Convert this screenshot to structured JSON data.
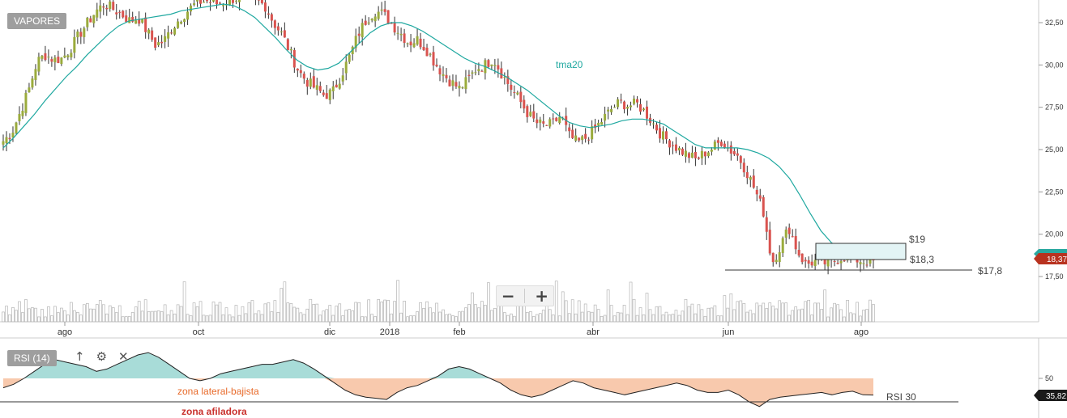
{
  "title": "VAPORES",
  "rsi_title": "RSI (14)",
  "icons": {
    "move_up": "arrow-up-icon",
    "settings": "gear-icon",
    "close": "close-icon"
  },
  "zoom": {
    "minus": "−",
    "plus": "+"
  },
  "colors": {
    "up_candle": "#9aab3c",
    "down_candle": "#d9534f",
    "sma_line": "#1fa8a0",
    "volume_bar": "#b5b5b5",
    "rsi_overbought_fill": "#a8dcd8",
    "rsi_oversold_fill": "#f8c9ad",
    "price_tag_teal": "#2aa8a0",
    "price_tag_red": "#b8321f"
  },
  "chart_data": [
    {
      "type": "candlestick",
      "ylim": [
        15.0,
        33.5
      ],
      "y_ticks": [
        "32,50",
        "30,00",
        "27,50",
        "25,00",
        "22,50",
        "20,00",
        "17,50"
      ],
      "y_tick_values": [
        32.5,
        30.0,
        27.5,
        25.0,
        22.5,
        20.0,
        17.5
      ],
      "x_ticks": [
        "ago",
        "oct",
        "dic",
        "2018",
        "feb",
        "abr",
        "jun",
        "ago"
      ],
      "overlay_label": "tma20",
      "annotations": {
        "box_high": "$19",
        "box_low": "$18,3",
        "support": "$17,8",
        "box_high_value": 19.0,
        "box_low_value": 18.3,
        "support_value": 17.8
      },
      "last_price_tags": [
        "18,37"
      ],
      "close_series": [
        25.5,
        26.0,
        27.2,
        28.5,
        30.2,
        30.6,
        30.3,
        30.4,
        31.0,
        31.8,
        32.5,
        33.2,
        33.6,
        33.3,
        33.0,
        32.6,
        32.8,
        32.0,
        31.2,
        31.4,
        32.2,
        32.8,
        33.3,
        33.7,
        33.8,
        33.6,
        33.7,
        33.9,
        34.0,
        34.0,
        33.8,
        33.5,
        32.5,
        31.8,
        30.7,
        29.6,
        29.0,
        28.6,
        28.2,
        28.4,
        29.4,
        30.5,
        31.8,
        32.7,
        33.2,
        33.0,
        32.4,
        31.9,
        31.3,
        31.5,
        31.0,
        30.2,
        29.5,
        29.0,
        28.6,
        29.1,
        29.8,
        30.0,
        30.4,
        29.5,
        28.7,
        28.0,
        27.2,
        26.6,
        26.4,
        26.5,
        27.0,
        25.8,
        25.4,
        25.7,
        26.2,
        26.8,
        27.4,
        27.8,
        27.6,
        27.7,
        27.2,
        26.5,
        25.8,
        25.4,
        25.0,
        24.7,
        24.4,
        24.8,
        25.1,
        25.5,
        25.0,
        24.6,
        23.7,
        22.6,
        21.3,
        18.3,
        19.3,
        20.4,
        19.0,
        18.2,
        18.4,
        18.3,
        18.3,
        18.6,
        18.7,
        18.5,
        18.4,
        18.37
      ],
      "sma20_series": [
        25.1,
        25.7,
        26.4,
        27.1,
        27.9,
        28.6,
        29.3,
        29.9,
        30.6,
        31.2,
        31.8,
        32.3,
        32.6,
        32.7,
        32.8,
        32.9,
        33.0,
        33.2,
        33.3,
        33.4,
        33.5,
        33.6,
        33.5,
        33.2,
        32.8,
        32.2,
        31.6,
        30.9,
        30.3,
        29.9,
        29.7,
        29.8,
        30.1,
        30.7,
        31.3,
        31.9,
        32.3,
        32.5,
        32.5,
        32.3,
        32.0,
        31.6,
        31.2,
        30.8,
        30.4,
        30.1,
        29.9,
        29.6,
        29.3,
        28.9,
        28.5,
        28.0,
        27.5,
        27.0,
        26.6,
        26.4,
        26.3,
        26.4,
        26.5,
        26.7,
        26.8,
        26.8,
        26.7,
        26.5,
        26.1,
        25.7,
        25.3,
        25.1,
        25.1,
        25.1,
        25.1,
        25.0,
        24.8,
        24.5,
        24.0,
        23.3,
        22.3,
        21.2,
        20.2,
        19.5,
        19.1,
        18.9,
        18.8,
        18.7
      ]
    },
    {
      "type": "area",
      "name": "RSI (14)",
      "ylim": [
        0,
        100
      ],
      "y_ticks": [
        "50"
      ],
      "reference_line_label": "RSI 30",
      "last_value_tag": "35,82",
      "zone_labels": [
        "zona lateral-bajista",
        "zona afiladora"
      ],
      "values": [
        42,
        45,
        50,
        56,
        62,
        66,
        64,
        62,
        60,
        56,
        58,
        62,
        66,
        70,
        72,
        68,
        62,
        56,
        50,
        48,
        50,
        54,
        56,
        58,
        60,
        62,
        62,
        64,
        66,
        63,
        58,
        52,
        46,
        40,
        36,
        34,
        33,
        32,
        38,
        42,
        44,
        48,
        52,
        58,
        60,
        58,
        54,
        50,
        46,
        40,
        36,
        34,
        36,
        40,
        44,
        48,
        46,
        42,
        40,
        38,
        36,
        38,
        40,
        42,
        44,
        46,
        44,
        40,
        38,
        38,
        40,
        36,
        30,
        26,
        32,
        34,
        35,
        36,
        37,
        38,
        36,
        38,
        39,
        36,
        35.82
      ]
    }
  ]
}
